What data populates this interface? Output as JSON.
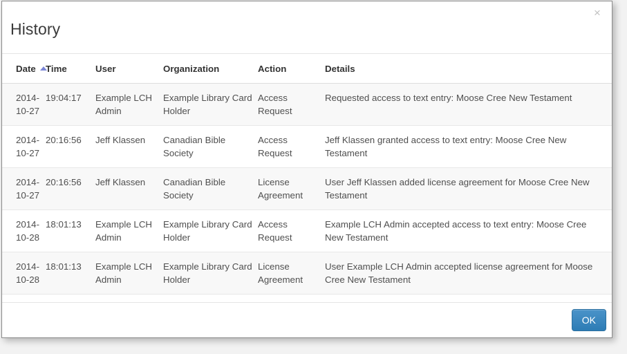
{
  "dialog": {
    "title": "History",
    "close_label": "×"
  },
  "table": {
    "columns": [
      {
        "key": "date",
        "label": "Date",
        "sort": "asc"
      },
      {
        "key": "time",
        "label": "Time",
        "sort": null
      },
      {
        "key": "user",
        "label": "User",
        "sort": null
      },
      {
        "key": "organization",
        "label": "Organization",
        "sort": null
      },
      {
        "key": "action",
        "label": "Action",
        "sort": null
      },
      {
        "key": "details",
        "label": "Details",
        "sort": null
      }
    ],
    "rows": [
      {
        "date": "2014-10-27",
        "time": "19:04:17",
        "user": "Example LCH Admin",
        "organization": "Example Library Card Holder",
        "action": "Access Request",
        "details": "Requested access to text entry: Moose Cree New Testament"
      },
      {
        "date": "2014-10-27",
        "time": "20:16:56",
        "user": "Jeff Klassen",
        "organization": "Canadian Bible Society",
        "action": "Access Request",
        "details": "Jeff Klassen granted access to text entry: Moose Cree New Testament"
      },
      {
        "date": "2014-10-27",
        "time": "20:16:56",
        "user": "Jeff Klassen",
        "organization": "Canadian Bible Society",
        "action": "License Agreement",
        "details": "User Jeff Klassen added license agreement for Moose Cree New Testament"
      },
      {
        "date": "2014-10-28",
        "time": "18:01:13",
        "user": "Example LCH Admin",
        "organization": "Example Library Card Holder",
        "action": "Access Request",
        "details": "Example LCH Admin accepted access to text entry: Moose Cree New Testament"
      },
      {
        "date": "2014-10-28",
        "time": "18:01:13",
        "user": "Example LCH Admin",
        "organization": "Example Library Card Holder",
        "action": "License Agreement",
        "details": "User Example LCH Admin accepted license agreement for Moose Cree New Testament"
      }
    ]
  },
  "footer": {
    "ok_label": "OK"
  },
  "colors": {
    "accent": "#2d7cb5",
    "sort_arrow": "#7b86d6",
    "stripe": "#f8f8f8",
    "text": "#4f4f4f"
  }
}
